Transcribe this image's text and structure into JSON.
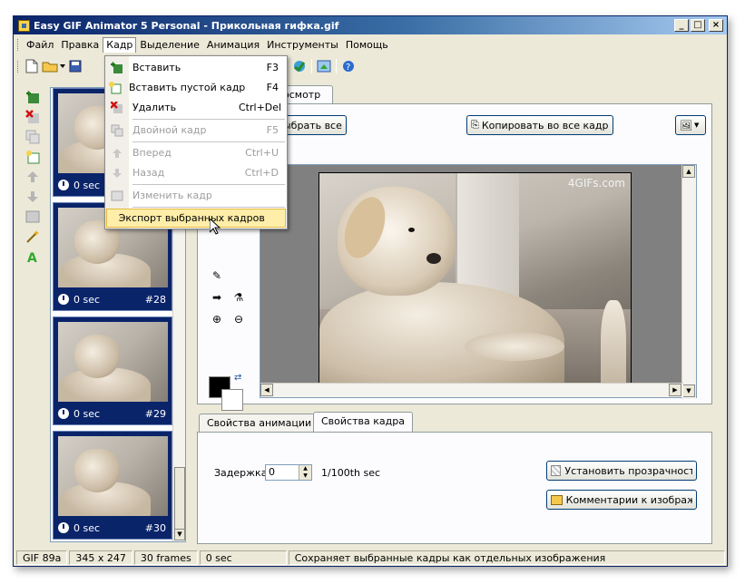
{
  "window": {
    "title": "Easy GIF Animator 5 Personal - Прикольная гифка.gif",
    "buttons": {
      "minimize": "_",
      "maximize": "□",
      "close": "×"
    }
  },
  "menubar": [
    "Файл",
    "Правка",
    "Кадр",
    "Выделение",
    "Анимация",
    "Инструменты",
    "Помощь"
  ],
  "toolbar": {
    "icons": [
      "new-file-icon",
      "open-folder-icon",
      "dropdown-arrow-icon",
      "save-icon",
      "play-icon",
      "preview-browser-icon",
      "export-icon",
      "help-icon"
    ]
  },
  "left_tools": [
    "add-frame-icon",
    "delete-frame-icon",
    "duplicate-frame-icon",
    "insert-blank-frame-icon",
    "move-up-icon",
    "move-down-icon",
    "resize-frame-icon",
    "magic-wand-icon",
    "text-icon"
  ],
  "frames": [
    {
      "delay": "0 sec",
      "number": ""
    },
    {
      "delay": "0 sec",
      "number": "#28"
    },
    {
      "delay": "0 sec",
      "number": "#29"
    },
    {
      "delay": "0 sec",
      "number": "#30"
    }
  ],
  "editor": {
    "tab": "осмотр",
    "select_all_label": "ыбрать все",
    "copy_all_label": "Копировать во все кадр",
    "watermark": "4GIFs.com"
  },
  "properties": {
    "tab_animation": "Свойства анимации",
    "tab_frame": "Свойства кадра",
    "delay_label": "Задержка:",
    "delay_value": "0",
    "delay_unit": "1/100th sec",
    "transparency_button": "Установить прозрачность",
    "comments_button": "Комментарии к изображен"
  },
  "statusbar": {
    "format": "GIF 89a",
    "size": "345 x 247",
    "frames": "30 frames",
    "delay": "0 sec",
    "message": "Сохраняет выбранные кадры как отдельных изображения"
  },
  "frame_menu": {
    "items": [
      {
        "label": "Вставить",
        "shortcut": "F3",
        "disabled": false,
        "icon": "add-frame-icon"
      },
      {
        "label": "Вставить пустой кадр",
        "shortcut": "F4",
        "disabled": false,
        "icon": "insert-blank-frame-icon"
      },
      {
        "label": "Удалить",
        "shortcut": "Ctrl+Del",
        "disabled": false,
        "icon": "delete-frame-icon"
      },
      {
        "label": "Двойной кадр",
        "shortcut": "F5",
        "disabled": true,
        "icon": "duplicate-frame-icon"
      },
      {
        "label": "Вперед",
        "shortcut": "Ctrl+U",
        "disabled": true,
        "icon": "move-up-icon"
      },
      {
        "label": "Назад",
        "shortcut": "Ctrl+D",
        "disabled": true,
        "icon": "move-down-icon"
      },
      {
        "label": "Изменить кадр",
        "shortcut": "",
        "disabled": true,
        "icon": "resize-frame-icon"
      },
      {
        "label": "Экспорт выбранных кадров",
        "shortcut": "",
        "disabled": false,
        "highlighted": true,
        "icon": ""
      }
    ]
  }
}
